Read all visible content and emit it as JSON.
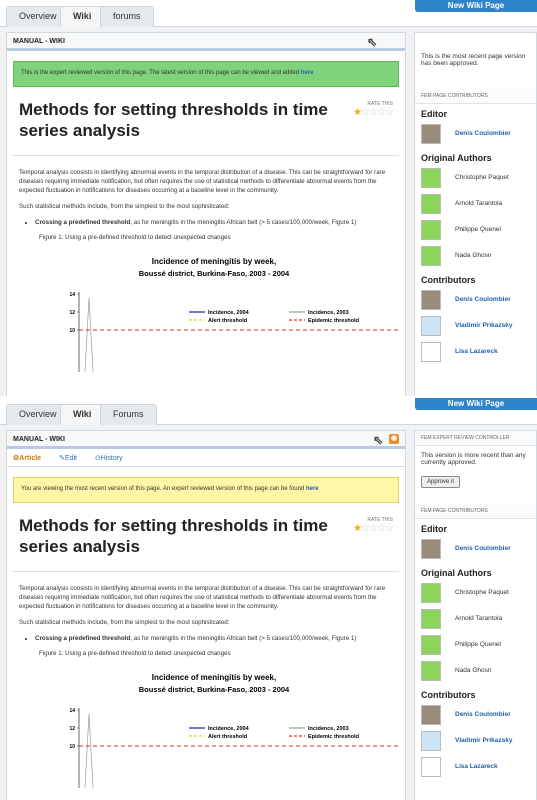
{
  "shot1": {
    "tabs": [
      "Overview",
      "Wiki",
      "forums"
    ],
    "new_wiki": "New Wiki Page",
    "header": "MANUAL - WIKI",
    "notice_pre": "This is the expert reviewed version of this page. The latest version of this page can be viewed and edited ",
    "notice_link": "here",
    "side_text": "This is the most recent page version has been approved.",
    "contributors_section": "FEM PAGE CONTRIBUTORS"
  },
  "shot2": {
    "tabs": [
      "Overview",
      "Wiki",
      "Forums"
    ],
    "new_wiki": "New Wiki Page",
    "header": "MANUAL - WIKI",
    "subtabs": [
      "Article",
      "Edit",
      "History"
    ],
    "notice_pre": "You are viewing the most recent version of this page. An expert reviewed version of this page can be found ",
    "notice_link": "here",
    "review_section": "FEM EXPERT REVIEW CONTROLLER",
    "review_text": "This version is more recent than any currently approved.",
    "approve_label": "Approve it",
    "contributors_section": "FEM PAGE CONTRIBUTORS"
  },
  "article": {
    "title": "Methods for setting thresholds in time series analysis",
    "rate_label": "RATE THIS",
    "para1": "Temporal analysis consists in identifying abnormal events in the temporal distribution of a disease. This can be straightforward for rare diseases requiring immediate notification, but often requires the use of statistical methods to differentiate abnormal events from the expected fluctuation in notifications for diseases occurring at a baseline level in the community.",
    "para2": "Such statistical methods include, from the simplest to the most sophisticated:",
    "bullet_bold": "Crossing a predefined threshold",
    "bullet_rest": ", as for meningitis in the meningitis African belt (> 5 cases/100,000/week, Figure 1)",
    "figure_caption": "Figure 1: Using a pre-defined threshold to detect unexpected changes"
  },
  "side": {
    "editor_h": "Editor",
    "editor": "Denis Coulombier",
    "authors_h": "Original Authors",
    "authors": [
      "Christophe Paquet",
      "Arnold Tarantola",
      "Philippe Quenel",
      "Nada Ghosn"
    ],
    "contributors_h": "Contributors",
    "contributors": [
      "Denis Coulombier",
      "Vladimir Prikazsky",
      "Lisa Lazareck"
    ]
  },
  "chart_data": {
    "type": "line",
    "title": "Incidence of meningitis by week,",
    "subtitle": "Boussé district, Burkina-Faso, 2003 - 2004",
    "y_ticks": [
      "14",
      "12",
      "10"
    ],
    "series": [
      {
        "name": "Incidence, 2004",
        "color": "#1a1aa6"
      },
      {
        "name": "Incidence, 2003",
        "color": "#999999"
      },
      {
        "name": "Alert threshold",
        "color": "#e6d000"
      },
      {
        "name": "Epidemic threshold",
        "color": "#e03030"
      }
    ],
    "epidemic_threshold": 10
  }
}
